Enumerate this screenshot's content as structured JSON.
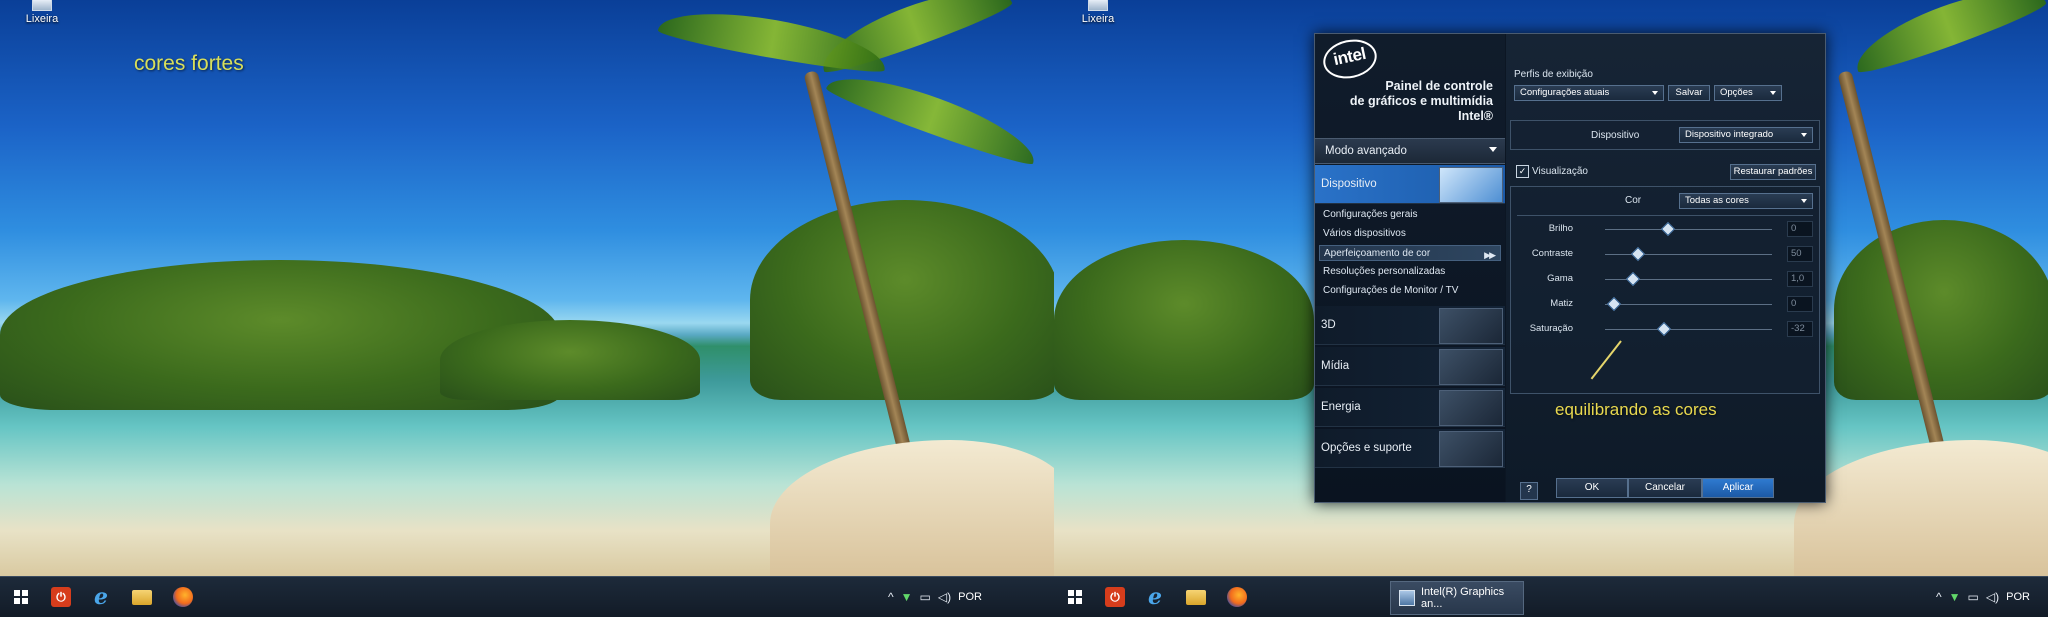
{
  "left_screen": {
    "desktop_icon_label": "Lixeira",
    "overlay_text": "cores fortes",
    "taskbar": {
      "tray_language": "POR"
    }
  },
  "right_screen": {
    "desktop_icon_label": "Lixeira",
    "overlay_text": "equilibrando as cores",
    "taskbar": {
      "running_app_label": "Intel(R) Graphics an...",
      "tray_language": "POR"
    }
  },
  "panel": {
    "logo": "intel",
    "title_lines": [
      "Painel de controle",
      "de gráficos e multimídia",
      "Intel®"
    ],
    "window_controls": {
      "minimize": "–",
      "close": "×"
    },
    "mode": "Modo avançado",
    "categories": [
      "Dispositivo",
      "3D",
      "Mídia",
      "Energia",
      "Opções e suporte"
    ],
    "selected_category": "Dispositivo",
    "subitems": [
      "Configurações gerais",
      "Vários dispositivos",
      "Aperfeiçoamento de cor",
      "Resoluções personalizadas",
      "Configurações de Monitor / TV"
    ],
    "selected_subitem": "Aperfeiçoamento de cor",
    "profiles_label": "Perfis de exibição",
    "profile_value": "Configurações atuais",
    "save_label": "Salvar",
    "options_label": "Opções",
    "device_label": "Dispositivo",
    "device_value": "Dispositivo integrado",
    "preview_label": "Visualização",
    "preview_checked": true,
    "restore_label": "Restaurar padrões",
    "color_label": "Cor",
    "color_value": "Todas as cores",
    "sliders": [
      {
        "label": "Brilho",
        "value": "0",
        "fraction": 0.37
      },
      {
        "label": "Contraste",
        "value": "50",
        "fraction": 0.19
      },
      {
        "label": "Gama",
        "value": "1,0",
        "fraction": 0.16
      },
      {
        "label": "Matiz",
        "value": "0",
        "fraction": 0.05
      },
      {
        "label": "Saturação",
        "value": "-32",
        "fraction": 0.35
      }
    ],
    "help_label": "?",
    "ok_label": "OK",
    "cancel_label": "Cancelar",
    "apply_label": "Aplicar"
  }
}
